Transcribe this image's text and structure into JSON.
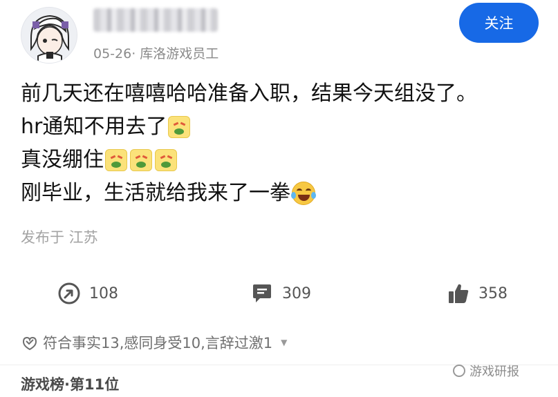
{
  "header": {
    "meta_text": "05-26· 库洛游戏员工",
    "follow_label": "关注"
  },
  "post": {
    "lines": [
      "前几天还在嘻嘻哈哈准备入职，结果今天组没了。",
      "hr通知不用去了",
      "真没绷住",
      "刚毕业，生活就给我来了一拳"
    ],
    "location": "发布于 江苏"
  },
  "actions": {
    "share_count": "108",
    "comment_count": "309",
    "like_count": "358"
  },
  "reactions": {
    "text": "符合事实13,感同身受10,言辞过激1"
  },
  "footer": {
    "rank": "游戏榜·第11位",
    "watermark": "游戏研报"
  },
  "colors": {
    "accent": "#1769e6",
    "meta_gray": "#8a8a8a",
    "icon_gray": "#555555"
  },
  "icons": {
    "share": "share-icon",
    "comment": "comment-icon",
    "like": "thumbs-up-icon",
    "reaction": "reaction-icon"
  }
}
